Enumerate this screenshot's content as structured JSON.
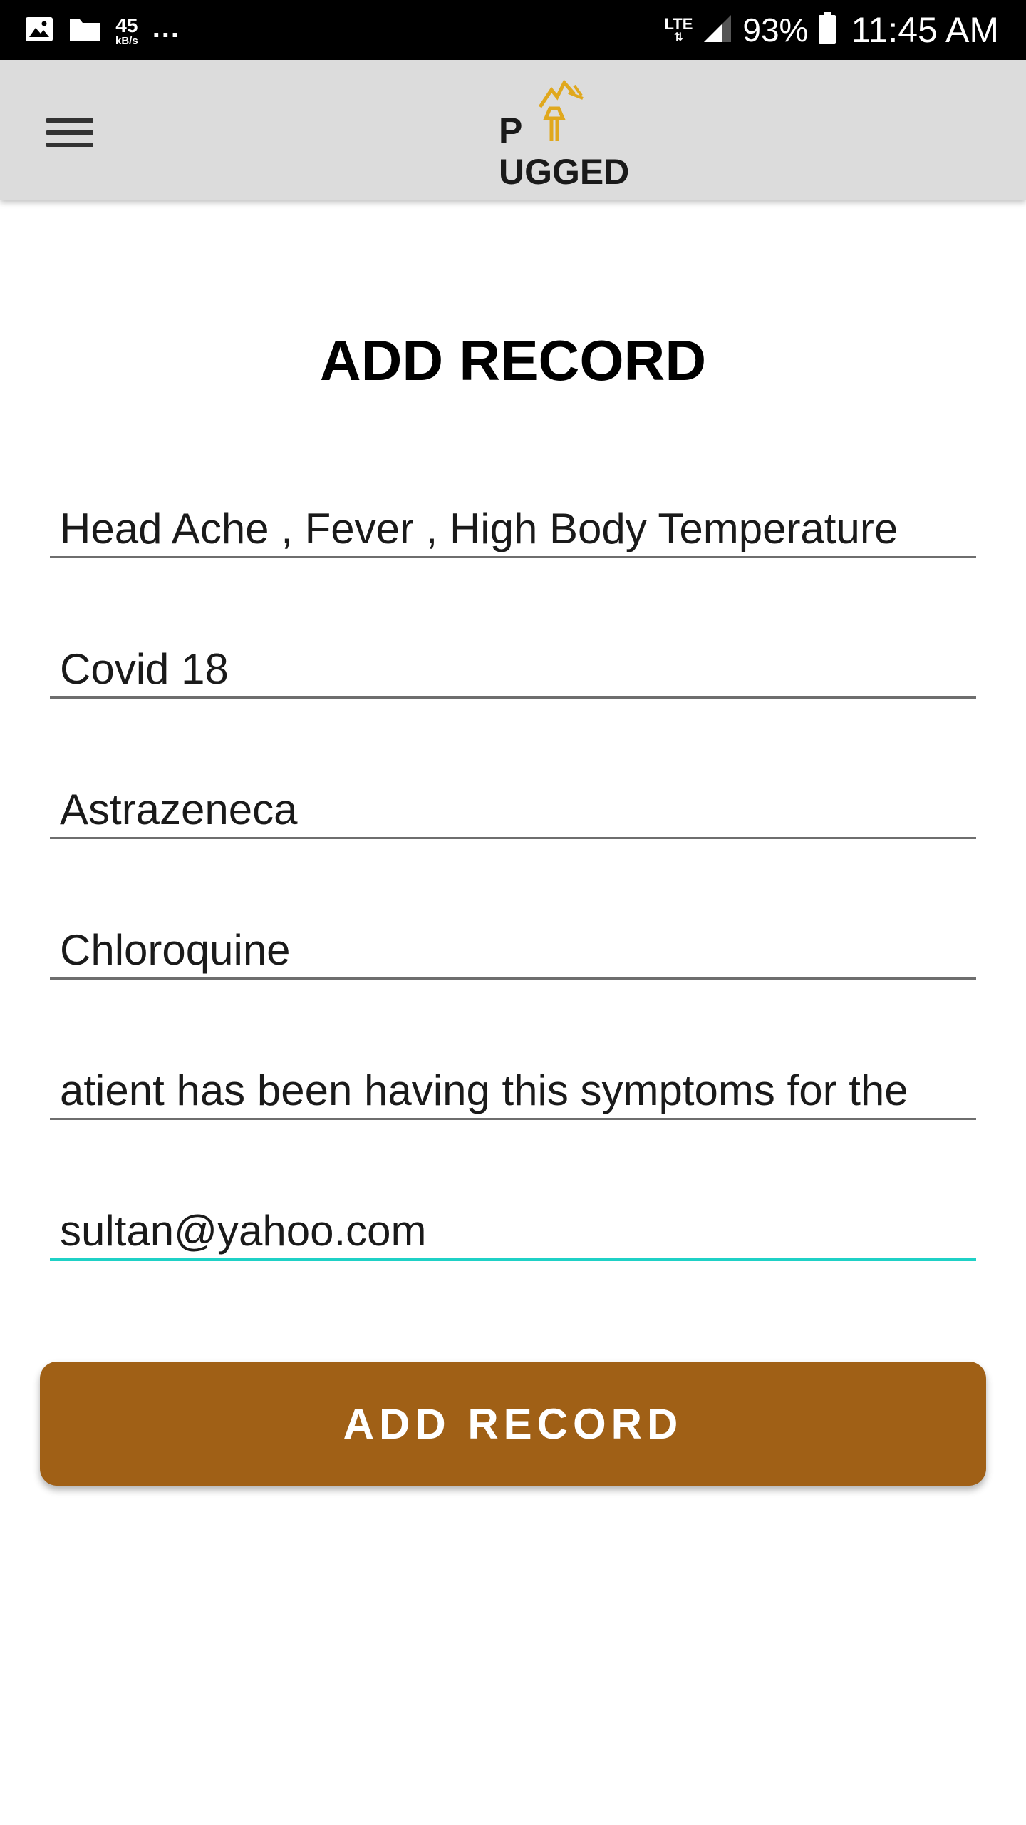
{
  "status_bar": {
    "speed_value": "45",
    "speed_unit": "kB/s",
    "more": "...",
    "network": "LTE",
    "battery": "93%",
    "time": "11:45 AM"
  },
  "app_bar": {
    "logo_text": "PLUGGED",
    "logo_prefix": "P",
    "logo_suffix": "UGGED"
  },
  "form": {
    "title": "ADD RECORD",
    "fields": [
      {
        "value": "Head Ache , Fever , High Body Temperature"
      },
      {
        "value": "Covid 18"
      },
      {
        "value": "Astrazeneca"
      },
      {
        "value": "Chloroquine"
      },
      {
        "value": "atient has been having this symptoms for the"
      },
      {
        "value": "sultan@yahoo.com"
      }
    ],
    "submit_label": "ADD RECORD"
  },
  "colors": {
    "accent": "#a06016",
    "active_underline": "#1fd1c6",
    "logo_gold": "#e0a81e",
    "app_bar_bg": "#dcdcdc"
  }
}
